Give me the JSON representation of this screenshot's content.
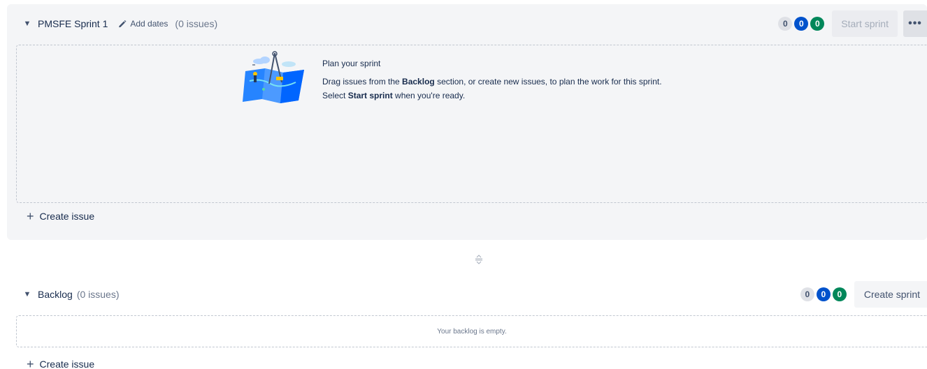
{
  "sprint": {
    "name": "PMSFE Sprint 1",
    "add_dates_label": "Add dates",
    "issue_count": "(0 issues)",
    "counts": {
      "todo": "0",
      "in_progress": "0",
      "done": "0"
    },
    "start_button": "Start sprint",
    "more_button": "•••",
    "empty_state": {
      "title": "Plan your sprint",
      "desc_1": "Drag issues from the ",
      "desc_bold_1": "Backlog",
      "desc_2": " section, or create new issues, to plan the work for this sprint. Select ",
      "desc_bold_2": "Start sprint",
      "desc_3": " when you're ready."
    },
    "create_issue": "Create issue"
  },
  "backlog": {
    "name": "Backlog",
    "issue_count": "(0 issues)",
    "counts": {
      "todo": "0",
      "in_progress": "0",
      "done": "0"
    },
    "create_sprint_button": "Create sprint",
    "empty_text": "Your backlog is empty.",
    "create_issue": "Create issue"
  },
  "icons": {
    "chevron": "chevron-down-icon",
    "edit": "pencil-icon",
    "add": "plus-icon",
    "divider": "drag-handle-icon"
  },
  "colors": {
    "todo_badge": "#dfe1e6",
    "in_progress_badge": "#0052cc",
    "done_badge": "#00875a",
    "sprint_bg": "#f4f5f7"
  }
}
